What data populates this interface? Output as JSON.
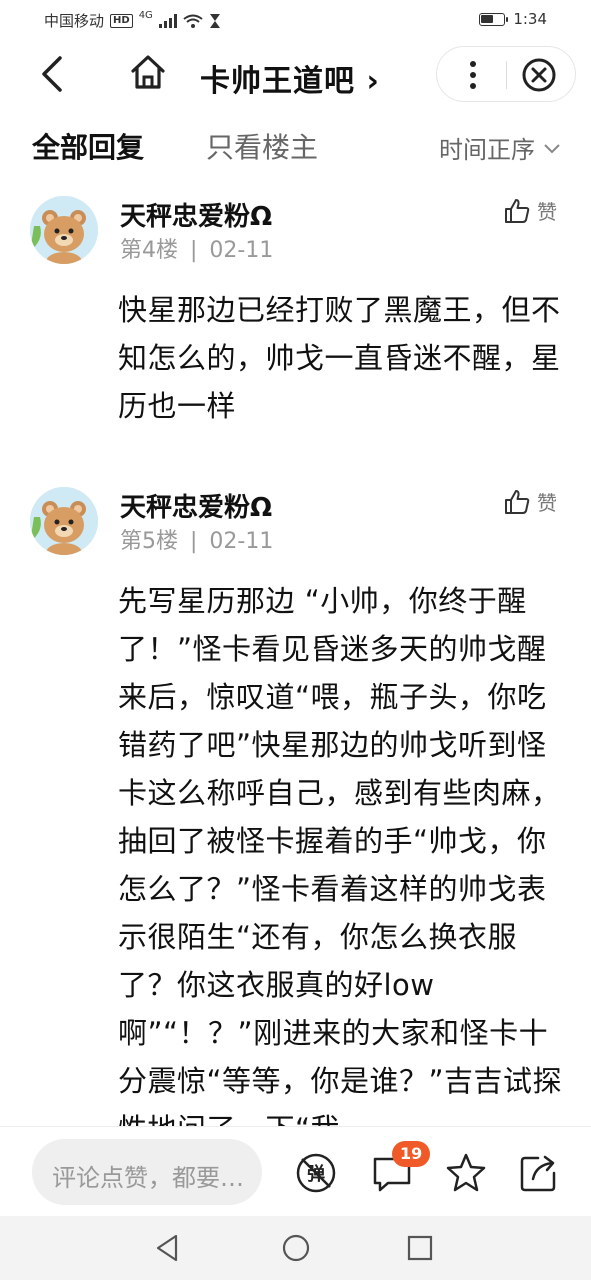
{
  "status_bar": {
    "carrier": "中国移动",
    "hd": "HD",
    "network": "4G",
    "time": "1:34",
    "battery_level": 0.55
  },
  "header": {
    "title": "卡帅王道吧",
    "title_chevron": "›",
    "icons": [
      "back-icon",
      "home-icon",
      "more-icon",
      "close-icon"
    ]
  },
  "tabs": {
    "all_replies": "全部回复",
    "only_op": "只看楼主",
    "sort": "时间正序"
  },
  "posts": [
    {
      "username": "天秤忠爱粉Ω",
      "floor": "第4楼",
      "date": "02-11",
      "like_label": "赞",
      "content": "快星那边已经打败了黑魔王，但不知怎么的，帅戈一直昏迷不醒，星历也一样"
    },
    {
      "username": "天秤忠爱粉Ω",
      "floor": "第5楼",
      "date": "02-11",
      "like_label": "赞",
      "content": "先写星历那边 “小帅，你终于醒了！”怪卡看见昏迷多天的帅戈醒来后，惊叹道“喂，瓶子头，你吃错药了吧”快星那边的帅戈听到怪卡这么称呼自己，感到有些肉麻，抽回了被怪卡握着的手“帅戈，你怎么了？”怪卡看着这样的帅戈表示很陌生“还有，你怎么换衣服了？你这衣服真的好low啊”“！？”刚进来的大家和怪卡十分震惊“等等，你是谁？”吉吉试探性地问了一下“我"
    }
  ],
  "bottom_bar": {
    "comment_placeholder": "评论点赞，都要…",
    "comment_count": "19",
    "icons": [
      "danmaku-icon",
      "comment-icon",
      "star-icon",
      "share-icon"
    ]
  },
  "nav_bar": {
    "icons": [
      "nav-back-icon",
      "nav-home-icon",
      "nav-recent-icon"
    ]
  },
  "colors": {
    "badge": "#f05a28",
    "text": "#111111",
    "muted": "#999999"
  }
}
